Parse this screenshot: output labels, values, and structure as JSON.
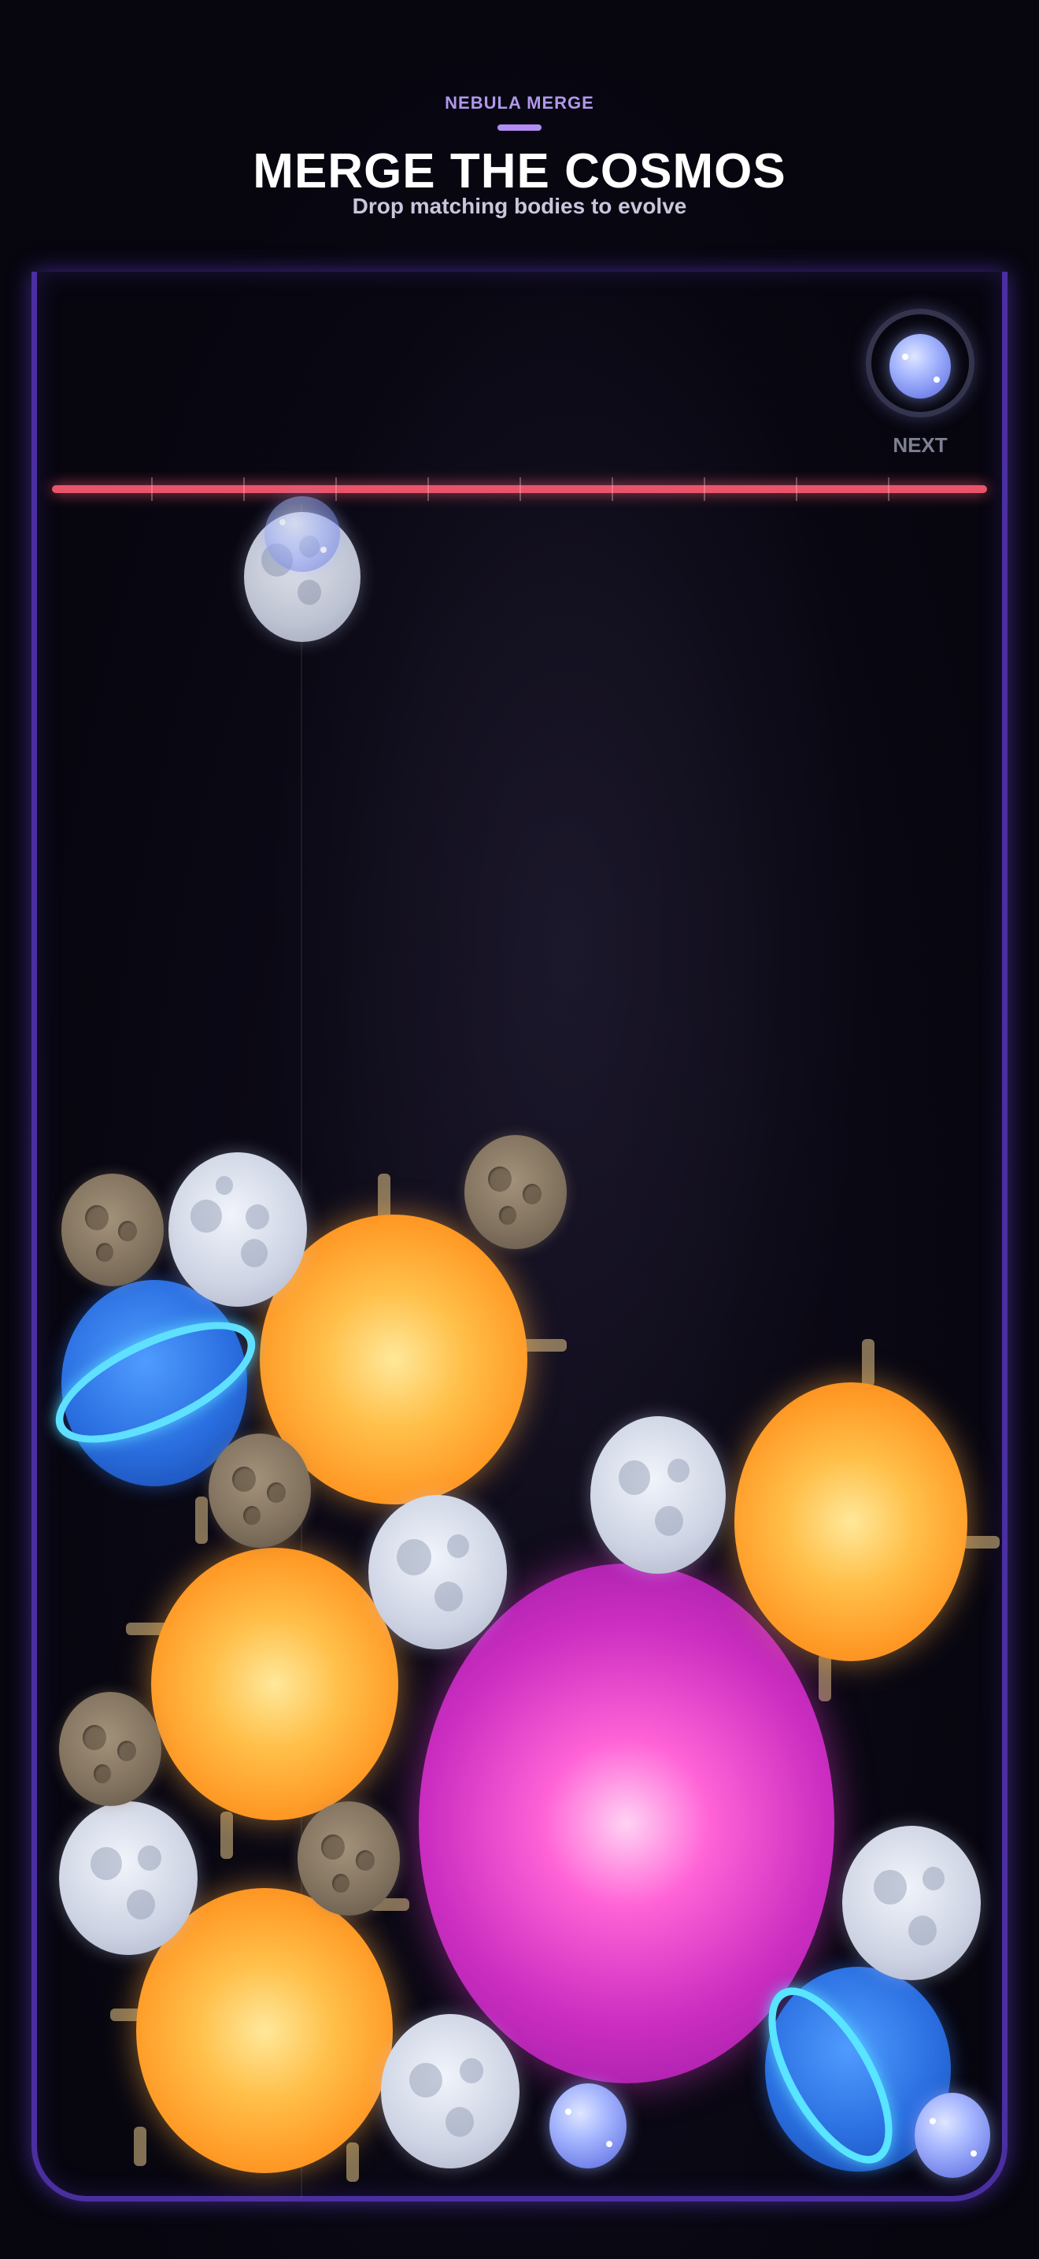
{
  "header": {
    "brand": "NEBULA MERGE",
    "title": "MERGE THE COSMOS",
    "subtitle": "Drop matching bodies to evolve"
  },
  "next_preview": {
    "label": "NEXT",
    "body": "comet"
  },
  "held_piece": {
    "body": "moon"
  },
  "colors": {
    "board_border": "#4a2fa0",
    "danger_line": "#e8546a",
    "brand_accent": "#b48cf5",
    "comet": "#a9b9ff",
    "asteroid": "#7f705d",
    "moon": "#cdd3e3",
    "planet": "#2a6ee0",
    "sun": "#ff9a26",
    "nebula": "#cc2ec1"
  },
  "body_types": [
    "comet",
    "asteroid",
    "moon",
    "planet",
    "sun",
    "nebula"
  ]
}
